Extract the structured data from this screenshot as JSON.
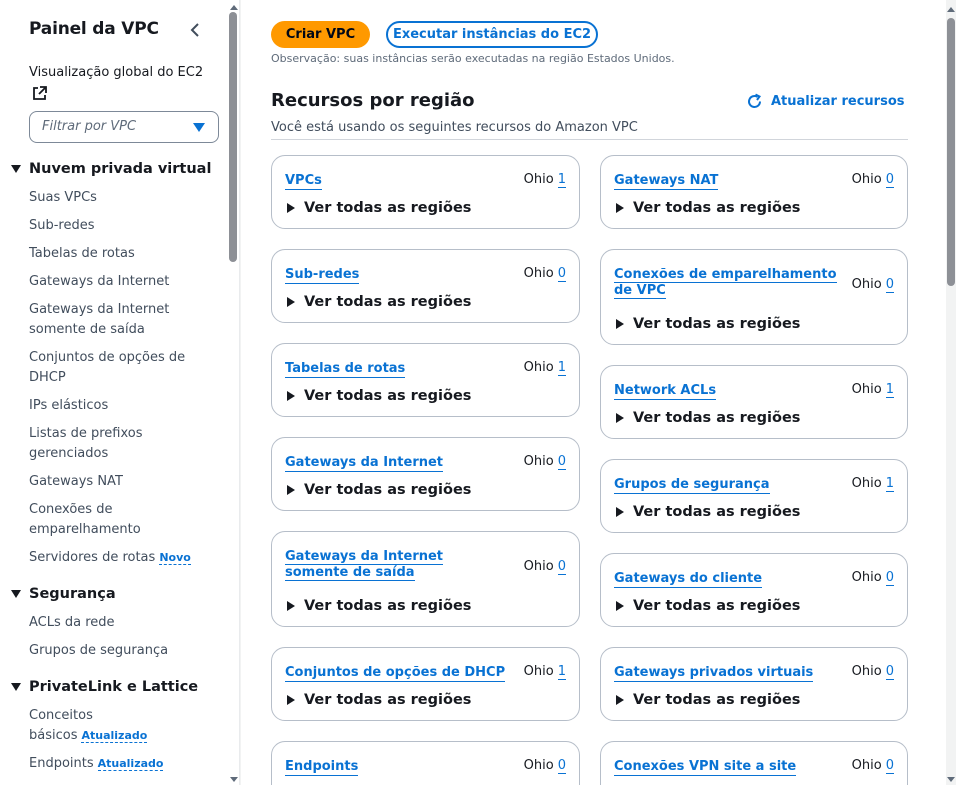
{
  "sidebar": {
    "title": "Painel da VPC",
    "ec2_link": "Visualização global do EC2",
    "filter_placeholder": "Filtrar por VPC",
    "sections": [
      {
        "label": "Nuvem privada virtual"
      },
      {
        "label": "Segurança"
      },
      {
        "label": "PrivateLink e Lattice"
      }
    ],
    "items": [
      {
        "label": "Suas VPCs"
      },
      {
        "label": "Sub-redes"
      },
      {
        "label": "Tabelas de rotas"
      },
      {
        "label": "Gateways da Internet"
      },
      {
        "label": "Gateways da Internet somente de saída"
      },
      {
        "label": "Conjuntos de opções de DHCP"
      },
      {
        "label": "IPs elásticos"
      },
      {
        "label": "Listas de prefixos gerenciados"
      },
      {
        "label": "Gateways NAT"
      },
      {
        "label": "Conexões de emparelhamento"
      },
      {
        "label": "Servidores de rotas",
        "badge": "Novo"
      },
      {
        "label": "ACLs da rede"
      },
      {
        "label": "Grupos de segurança"
      },
      {
        "label": "Conceitos básicos",
        "badge": "Atualizado"
      },
      {
        "label": "Endpoints",
        "badge": "Atualizado"
      }
    ]
  },
  "actions": {
    "create_vpc": "Criar VPC",
    "launch_ec2": "Executar instâncias do EC2",
    "note": "Observação: suas instâncias serão executadas na região Estados Unidos."
  },
  "resources": {
    "title": "Recursos por região",
    "refresh": "Atualizar recursos",
    "subtitle": "Você está usando os seguintes recursos do Amazon VPC",
    "expand_label": "Ver todas as regiões",
    "region": "Ohio",
    "left": [
      {
        "name": "VPCs",
        "count": "1"
      },
      {
        "name": "Sub-redes",
        "count": "0"
      },
      {
        "name": "Tabelas de rotas",
        "count": "1"
      },
      {
        "name": "Gateways da Internet",
        "count": "0"
      },
      {
        "name": "Gateways da Internet somente de saída",
        "count": "0"
      },
      {
        "name": "Conjuntos de opções de DHCP",
        "count": "1"
      },
      {
        "name": "Endpoints",
        "count": "0"
      }
    ],
    "right": [
      {
        "name": "Gateways NAT",
        "count": "0"
      },
      {
        "name": "Conexões de emparelhamento de VPC",
        "count": "0"
      },
      {
        "name": "Network ACLs",
        "count": "1"
      },
      {
        "name": "Grupos de segurança",
        "count": "1"
      },
      {
        "name": "Gateways do cliente",
        "count": "0"
      },
      {
        "name": "Gateways privados virtuais",
        "count": "0"
      },
      {
        "name": "Conexões VPN site a site",
        "count": "0"
      }
    ]
  },
  "colors": {
    "primary": "#ff9900",
    "link": "#0972d3"
  }
}
